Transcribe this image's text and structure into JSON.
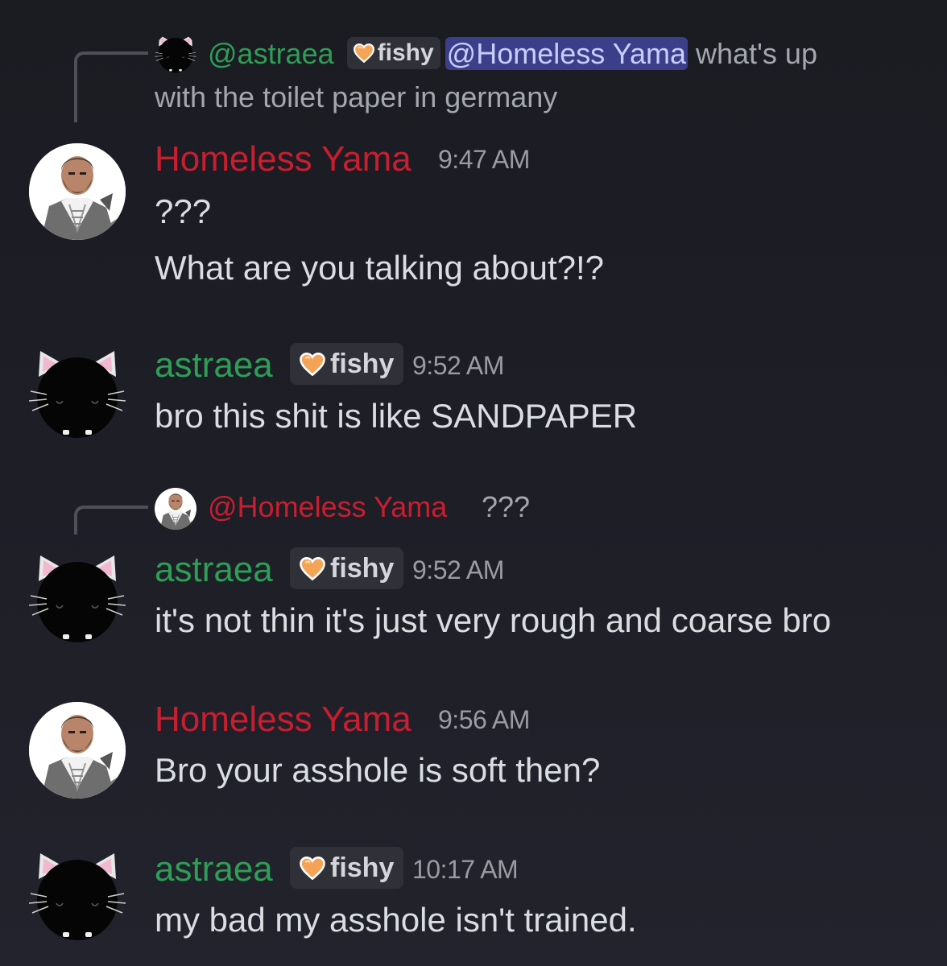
{
  "messages": [
    {
      "reply": {
        "author": "@astraea",
        "tag": "fishy",
        "mention": "@Homeless Yama",
        "text_line1": " what's up",
        "text_line2": "with the toilet paper in germany"
      },
      "author": "Homeless Yama",
      "time": "9:47 AM",
      "lines": [
        "???",
        "What are you talking about?!?"
      ]
    },
    {
      "author": "astraea",
      "tag": "fishy",
      "time": "9:52 AM",
      "lines": [
        "bro this shit is like SANDPAPER"
      ]
    },
    {
      "reply": {
        "author": "@Homeless Yama",
        "text": "???"
      },
      "author": "astraea",
      "tag": "fishy",
      "time": "9:52 AM",
      "lines": [
        "it's not thin it's just very rough and coarse bro"
      ]
    },
    {
      "author": "Homeless Yama",
      "time": "9:56 AM",
      "lines": [
        "Bro your asshole is soft then?"
      ]
    },
    {
      "author": "astraea",
      "tag": "fishy",
      "time": "10:17 AM",
      "lines": [
        "my bad my asshole isn't trained."
      ]
    }
  ],
  "colors": {
    "background": "#1e1e27",
    "yama_name": "#c81e2f",
    "astraea_name": "#2e9e56",
    "mention_bg": "#3b3f8a",
    "tag_bg": "#2f3038"
  },
  "icons": {
    "tag_icon": "orange-heart-icon",
    "yama_avatar": "bearded-man-avatar",
    "astraea_avatar": "black-cat-avatar"
  }
}
